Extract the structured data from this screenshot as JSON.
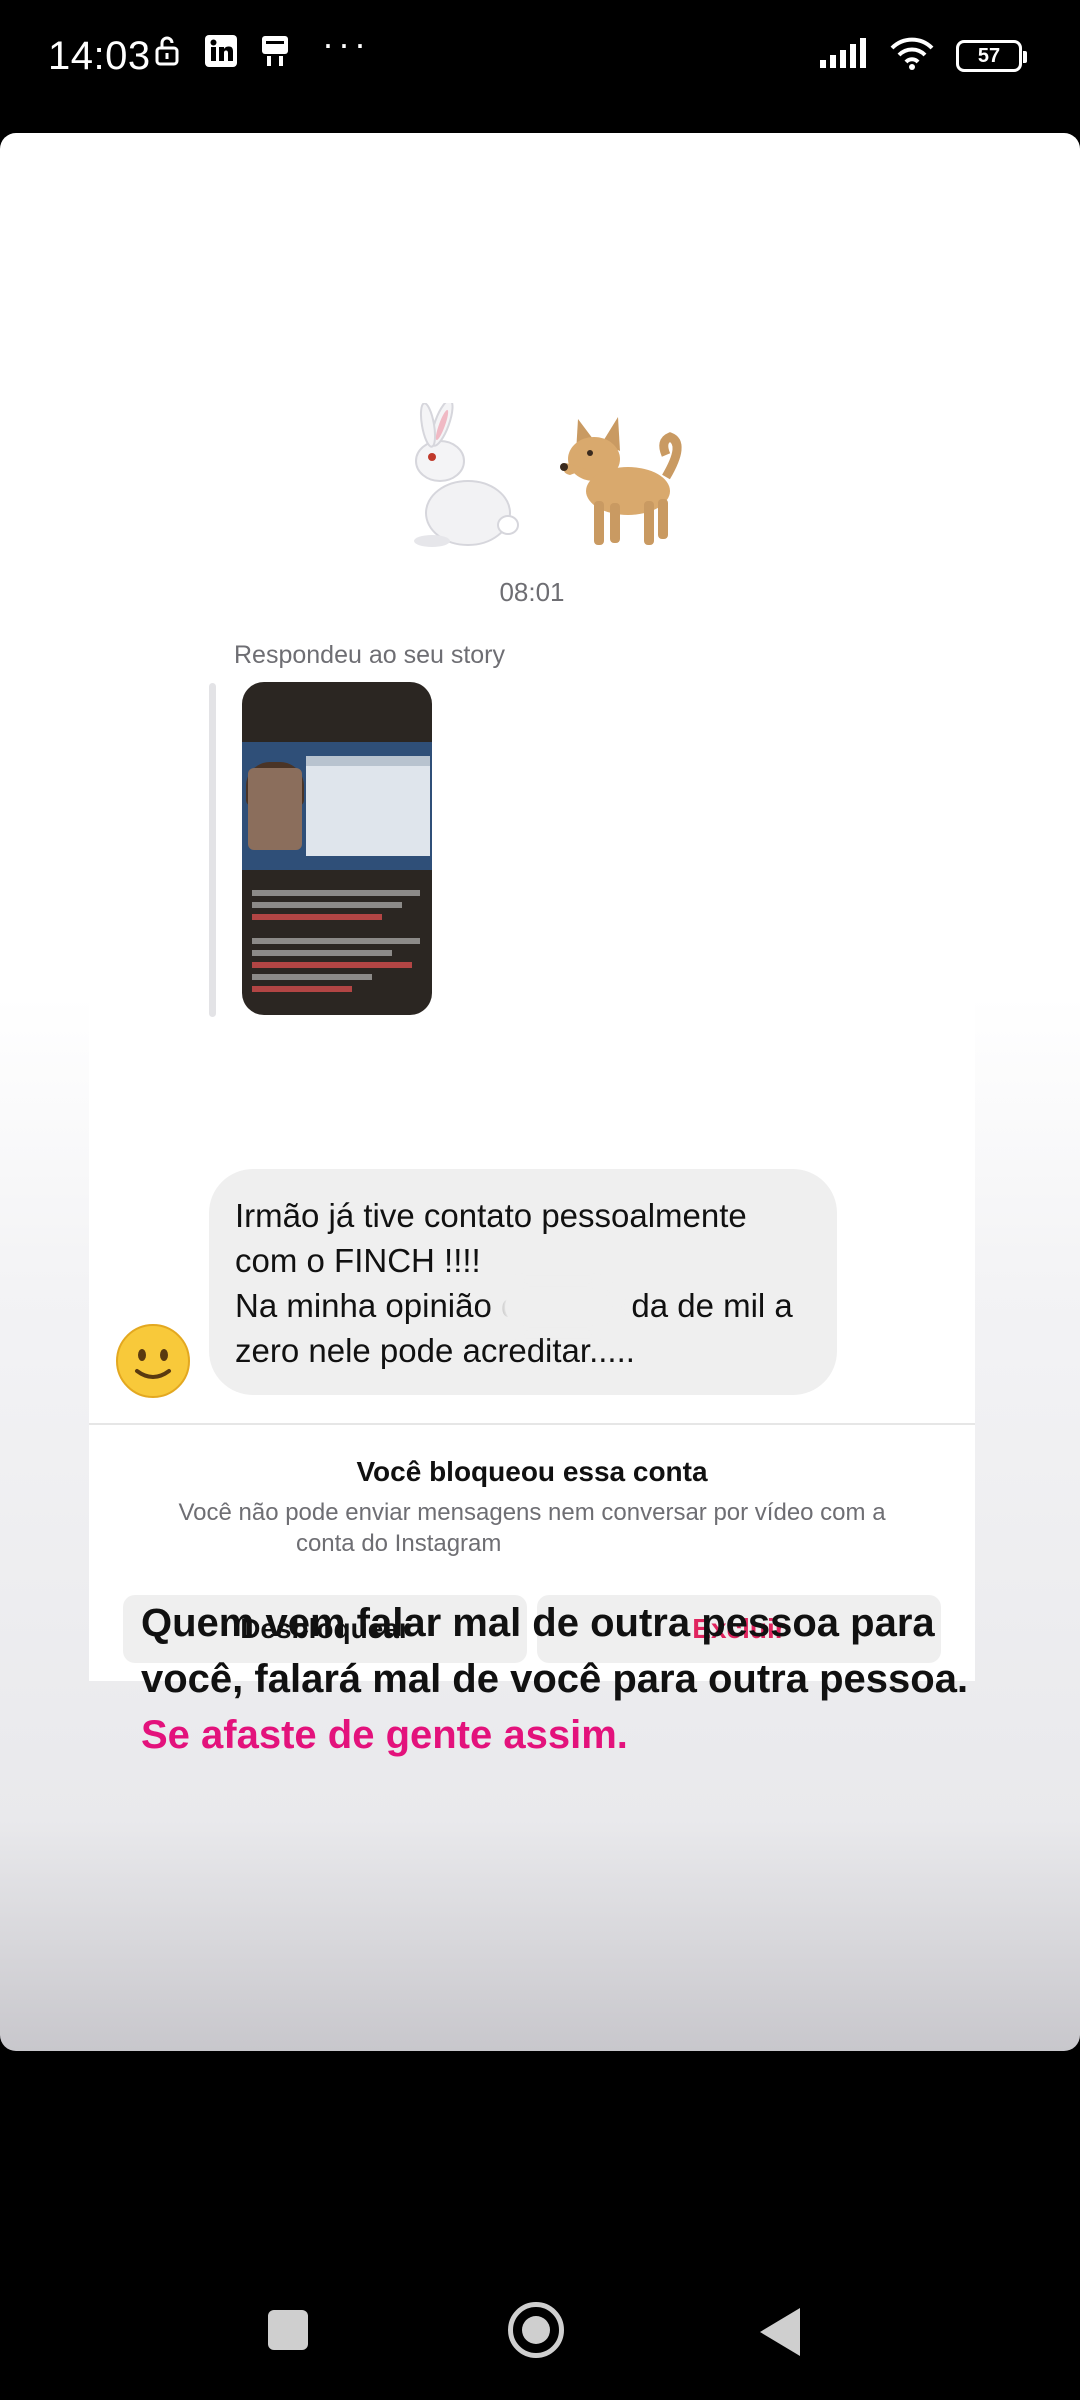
{
  "status_bar": {
    "time": "14:03",
    "battery": "57",
    "left_icons": [
      "lock-open-icon",
      "linkedin-icon",
      "notification-icon",
      "more-icon"
    ],
    "right_icons": [
      "signal-icon",
      "wifi-icon",
      "battery-icon"
    ]
  },
  "story": {
    "emojis": [
      "rabbit-icon",
      "dog-icon"
    ],
    "chat": {
      "timestamp": "08:01",
      "reply_label": "Respondeu ao seu story",
      "message_line1": "Irmão já tive contato pessoalmente",
      "message_line2": "com o FINCH !!!!",
      "message_line3": "Na minha opinião o",
      "message_line3_end": "da de mil a",
      "message_line4": "zero nele pode acreditar.....",
      "blocked_title": "Você bloqueou essa conta",
      "blocked_desc_1": "Você não pode enviar mensagens nem conversar por vídeo com a",
      "blocked_desc_2": "conta do Instagram",
      "unblock_label": "Desbloquear",
      "delete_label": "Excluir",
      "delete_color": "#e0245e"
    },
    "quote_main": "Quem vem falar mal de outra pessoa para você, falará mal de você para outra pessoa.",
    "quote_accent": "Se afaste de gente assim.",
    "accent_color": "#e3127c"
  },
  "nav": {
    "buttons": [
      "recents-button",
      "home-button",
      "back-button"
    ]
  }
}
